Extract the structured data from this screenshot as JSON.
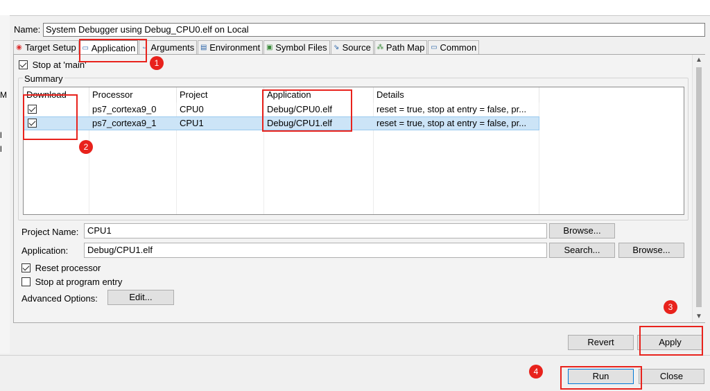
{
  "left_fragments": [
    "M",
    "l",
    "l"
  ],
  "name": {
    "label": "Name:",
    "value": "System Debugger using Debug_CPU0.elf on Local"
  },
  "tabs": [
    {
      "label": "Target Setup",
      "icon": "target-icon"
    },
    {
      "label": "Application",
      "icon": "window-icon"
    },
    {
      "label": "Arguments",
      "icon": "arguments-icon"
    },
    {
      "label": "Environment",
      "icon": "environment-icon"
    },
    {
      "label": "Symbol Files",
      "icon": "symbol-files-icon"
    },
    {
      "label": "Source",
      "icon": "source-icon"
    },
    {
      "label": "Path Map",
      "icon": "path-map-icon"
    },
    {
      "label": "Common",
      "icon": "common-icon"
    }
  ],
  "stop_at_main": {
    "label": "Stop at 'main'",
    "checked": true
  },
  "summary": {
    "label": "Summary",
    "columns": [
      "Download",
      "Processor",
      "Project",
      "Application",
      "Details"
    ],
    "rows": [
      {
        "download": true,
        "processor": "ps7_cortexa9_0",
        "project": "CPU0",
        "application": "Debug/CPU0.elf",
        "details": "reset = true, stop at entry = false, pr...",
        "selected": false
      },
      {
        "download": true,
        "processor": "ps7_cortexa9_1",
        "project": "CPU1",
        "application": "Debug/CPU1.elf",
        "details": "reset = true, stop at entry = false, pr...",
        "selected": true
      }
    ]
  },
  "project_name": {
    "label": "Project Name:",
    "value": "CPU1",
    "browse": "Browse..."
  },
  "application": {
    "label": "Application:",
    "value": "Debug/CPU1.elf",
    "search": "Search...",
    "browse": "Browse..."
  },
  "reset_processor": {
    "label": "Reset processor",
    "checked": true
  },
  "stop_at_entry": {
    "label": "Stop at program entry",
    "checked": false
  },
  "advanced": {
    "label": "Advanced Options:",
    "edit": "Edit..."
  },
  "buttons": {
    "revert": "Revert",
    "apply": "Apply",
    "run": "Run",
    "close": "Close"
  },
  "annotations": [
    "1",
    "2",
    "3",
    "4"
  ],
  "colors": {
    "annotation": "#e8221c",
    "selection": "#cce4f7"
  }
}
